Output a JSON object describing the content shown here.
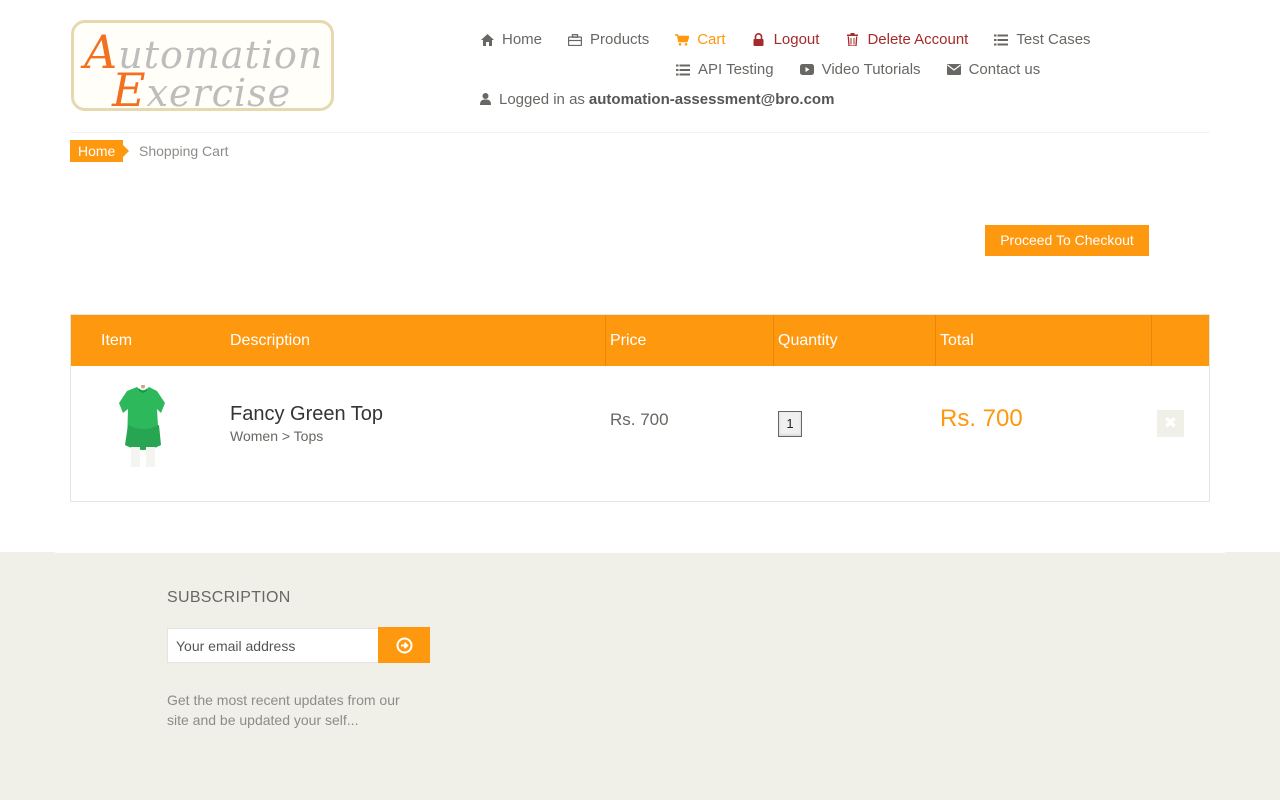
{
  "header": {
    "logo_text": "Automation Exercise",
    "nav": [
      {
        "label": "Home",
        "icon": "home-icon"
      },
      {
        "label": "Products",
        "icon": "briefcase-icon"
      },
      {
        "label": "Cart",
        "icon": "cart-icon"
      },
      {
        "label": "Logout",
        "icon": "lock-icon"
      },
      {
        "label": "Delete Account",
        "icon": "trash-icon"
      },
      {
        "label": "Test Cases",
        "icon": "list-icon"
      },
      {
        "label": "API Testing",
        "icon": "list-icon"
      },
      {
        "label": "Video Tutorials",
        "icon": "youtube-icon"
      },
      {
        "label": "Contact us",
        "icon": "envelope-icon"
      }
    ],
    "logged_in_prefix": "Logged in as",
    "logged_in_user": "automation-assessment@bro.com"
  },
  "breadcrumb": {
    "home": "Home",
    "current": "Shopping Cart"
  },
  "checkout_button": "Proceed To Checkout",
  "cart": {
    "columns": [
      "Item",
      "Description",
      "Price",
      "Quantity",
      "Total"
    ],
    "rows": [
      {
        "name": "Fancy Green Top",
        "category": "Women > Tops",
        "price": "Rs. 700",
        "quantity": "1",
        "total": "Rs. 700"
      }
    ]
  },
  "footer": {
    "subscription_title": "SUBSCRIPTION",
    "email_placeholder": "Your email address",
    "subscription_text": "Get the most recent updates from our site and be updated your self..."
  },
  "colors": {
    "accent": "#fe980f",
    "danger": "#a52a2a",
    "footer_bg": "#f0f0e9"
  }
}
